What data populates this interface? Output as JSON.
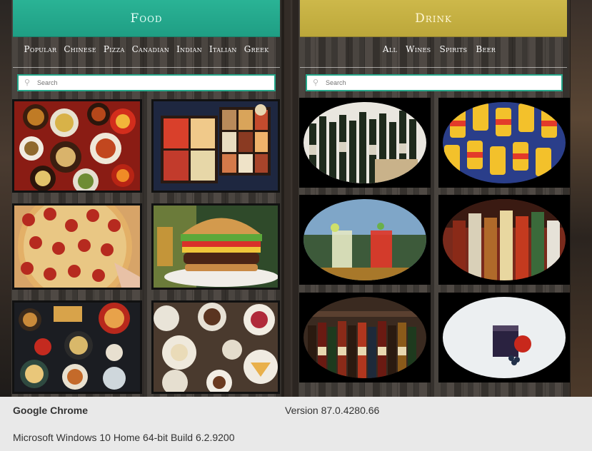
{
  "food": {
    "title": "Food",
    "tabs": [
      "Popular",
      "Chinese",
      "Pizza",
      "Canadian",
      "Indian",
      "Italian",
      "Greek"
    ],
    "search_placeholder": "Search",
    "accent": "#2ab395"
  },
  "drink": {
    "title": "Drink",
    "tabs": [
      "All",
      "Wines",
      "Spirits",
      "Beer"
    ],
    "search_placeholder": "Search",
    "accent": "#cdb84a"
  },
  "footer": {
    "browser": "Google Chrome",
    "version": "Version 87.0.4280.66",
    "os": "Microsoft Windows 10 Home 64-bit Build 6.2.9200"
  }
}
